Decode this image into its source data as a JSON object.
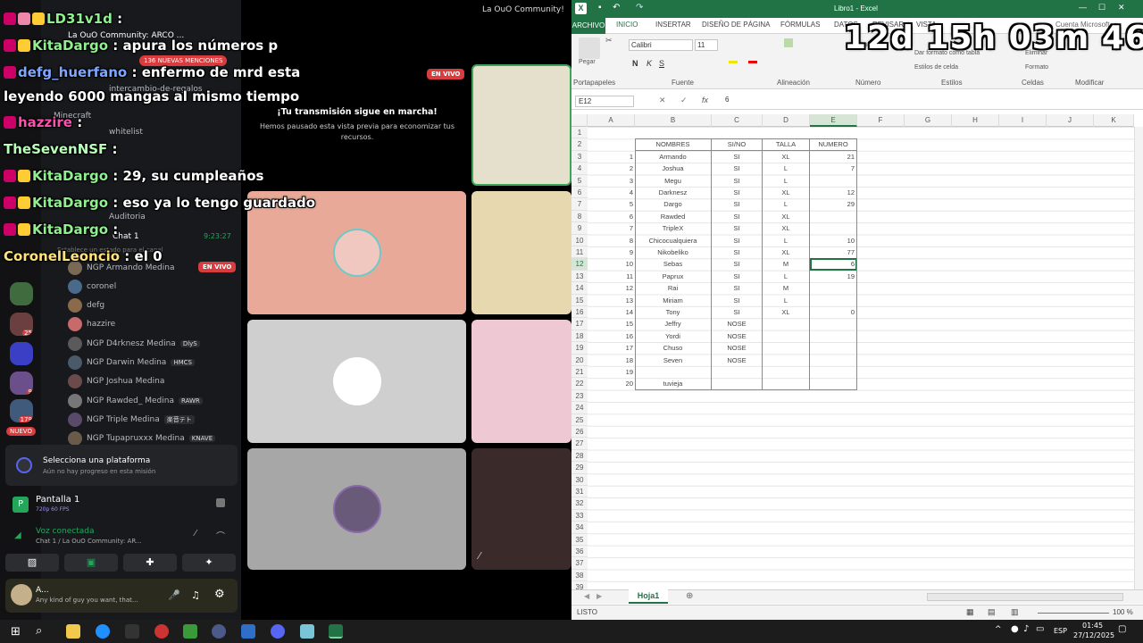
{
  "discord": {
    "server_title": "La OuO Community!",
    "header_server": "La OuO Community: ARCO ...",
    "mentions_badge": "136 NUEVAS MENCIONES",
    "channels": [
      "intercambio-de-regalos",
      "Minecraft",
      "whitelist",
      "Intercambio de regalos",
      "Auditoria"
    ],
    "voice_channel": "Chat 1",
    "voice_time": "9:23:27",
    "voice_desc": "Establece un estado para el canal",
    "voice_badge": "EN VIVO",
    "members": [
      {
        "name": "NGP Armando Medina",
        "tag": ""
      },
      {
        "name": "coronel",
        "tag": ""
      },
      {
        "name": "defg",
        "tag": ""
      },
      {
        "name": "hazzire",
        "tag": ""
      },
      {
        "name": "NGP D4rknesz Medina",
        "tag": "DlyS"
      },
      {
        "name": "NGP Darwin Medina",
        "tag": "HMCS"
      },
      {
        "name": "NGP Joshua Medina",
        "tag": ""
      },
      {
        "name": "NGP Rawded_ Medina",
        "tag": "RAWR"
      },
      {
        "name": "NGP Triple Medina",
        "tag": "楽音テト"
      },
      {
        "name": "NGP Tupapruxxx Medina",
        "tag": "KNAVE"
      }
    ],
    "server_badges": [
      "3",
      "25",
      "27",
      "2",
      "179",
      "9",
      "NUEVO"
    ],
    "mission_title": "Selecciona una plataforma",
    "mission_sub": "Aún no hay progreso en esta misión",
    "screen_title": "Pantalla 1",
    "screen_sub": "720p 60 FPS",
    "voice_connected": "Voz conectada",
    "voice_connected_sub": "Chat 1 / La OuO Community: AR...",
    "user_name": "A...",
    "user_status": "Any kind of guy you want, that...",
    "stream_live": "EN VIVO",
    "stream_paused_title": "¡Tu transmisión sigue en marcha!",
    "stream_paused_sub": "Hemos pausado esta vista previa para economizar tus recursos."
  },
  "chat_overlay": [
    {
      "name": "LD31v1d",
      "msg": ""
    },
    {
      "name": "KitaDargo",
      "msg": "apura los números p"
    },
    {
      "name": "defg_huerfano",
      "msg": "enfermo de mrd esta"
    },
    {
      "name": "",
      "msg": "leyendo 6000 mangas al mismo tiempo"
    },
    {
      "name": "hazzire",
      "msg": ""
    },
    {
      "name": "TheSevenNSF",
      "msg": ""
    },
    {
      "name": "KitaDargo",
      "msg": "29, su cumpleaños"
    },
    {
      "name": "KitaDargo",
      "msg": "eso ya lo tengo guardado"
    },
    {
      "name": "KitaDargo",
      "msg": ""
    },
    {
      "name": "CoronelLeoncio",
      "msg": "el 0"
    }
  ],
  "timer": "12d 15h 03m 46s",
  "excel": {
    "window_title": "Libro1 - Excel",
    "account": "Cuenta Microsoft",
    "tabs": [
      "ARCHIVO",
      "INICIO",
      "INSERTAR",
      "DISEÑO DE PÁGINA",
      "FÓRMULAS",
      "DATOS",
      "REVISAR",
      "VISTA"
    ],
    "ribbon_groups": [
      "Portapapeles",
      "Fuente",
      "Alineación",
      "Número",
      "Estilos",
      "Celdas",
      "Modificar"
    ],
    "paste_label": "Pegar",
    "font_name": "Calibri",
    "font_size": "11",
    "style_items": [
      "Dar formato como tabla",
      "Estilos de celda"
    ],
    "cell_items": [
      "Eliminar",
      "Formato"
    ],
    "name_box": "E12",
    "formula_value": "6",
    "columns": [
      "A",
      "B",
      "C",
      "D",
      "E",
      "F",
      "G",
      "H",
      "I",
      "J",
      "K"
    ],
    "headers": [
      "NOMBRES",
      "SI/NO",
      "TALLA",
      "NUMERO"
    ],
    "rows": [
      [
        "1",
        "Armando",
        "SI",
        "XL",
        "21"
      ],
      [
        "2",
        "Joshua",
        "SI",
        "L",
        "7"
      ],
      [
        "3",
        "Megu",
        "SI",
        "L",
        ""
      ],
      [
        "4",
        "Darknesz",
        "SI",
        "XL",
        "12"
      ],
      [
        "5",
        "Dargo",
        "SI",
        "L",
        "29"
      ],
      [
        "6",
        "Rawded",
        "SI",
        "XL",
        ""
      ],
      [
        "7",
        "TripleX",
        "SI",
        "XL",
        ""
      ],
      [
        "8",
        "Chicocualquiera",
        "SI",
        "L",
        "10"
      ],
      [
        "9",
        "Nikobeliko",
        "SI",
        "XL",
        "77"
      ],
      [
        "10",
        "Sebas",
        "SI",
        "M",
        "6"
      ],
      [
        "11",
        "Paprux",
        "SI",
        "L",
        "19"
      ],
      [
        "12",
        "Rai",
        "SI",
        "M",
        ""
      ],
      [
        "13",
        "Miriam",
        "SI",
        "L",
        ""
      ],
      [
        "14",
        "Tony",
        "SI",
        "XL",
        "0"
      ],
      [
        "15",
        "Jeffry",
        "NOSE",
        "",
        ""
      ],
      [
        "16",
        "Yordi",
        "NOSE",
        "",
        ""
      ],
      [
        "17",
        "Chuso",
        "NOSE",
        "",
        ""
      ],
      [
        "18",
        "Seven",
        "NOSE",
        "",
        ""
      ],
      [
        "19",
        "",
        "",
        "",
        ""
      ],
      [
        "20",
        "tuvieja",
        "",
        "",
        ""
      ]
    ],
    "row_numbers": [
      "1",
      "2",
      "3",
      "4",
      "5",
      "6",
      "7",
      "8",
      "9",
      "10",
      "11",
      "12",
      "13",
      "14",
      "15",
      "16",
      "17",
      "18",
      "19",
      "20",
      "21",
      "22",
      "23",
      "24",
      "25",
      "26",
      "27",
      "28",
      "29",
      "30",
      "31",
      "32",
      "33",
      "34",
      "35",
      "36",
      "37",
      "38",
      "39"
    ],
    "sheet_tab": "Hoja1",
    "status": "LISTO",
    "zoom": "100 %"
  },
  "taskbar": {
    "lang": "ESP",
    "time": "01:45",
    "date": "27/12/2025"
  }
}
